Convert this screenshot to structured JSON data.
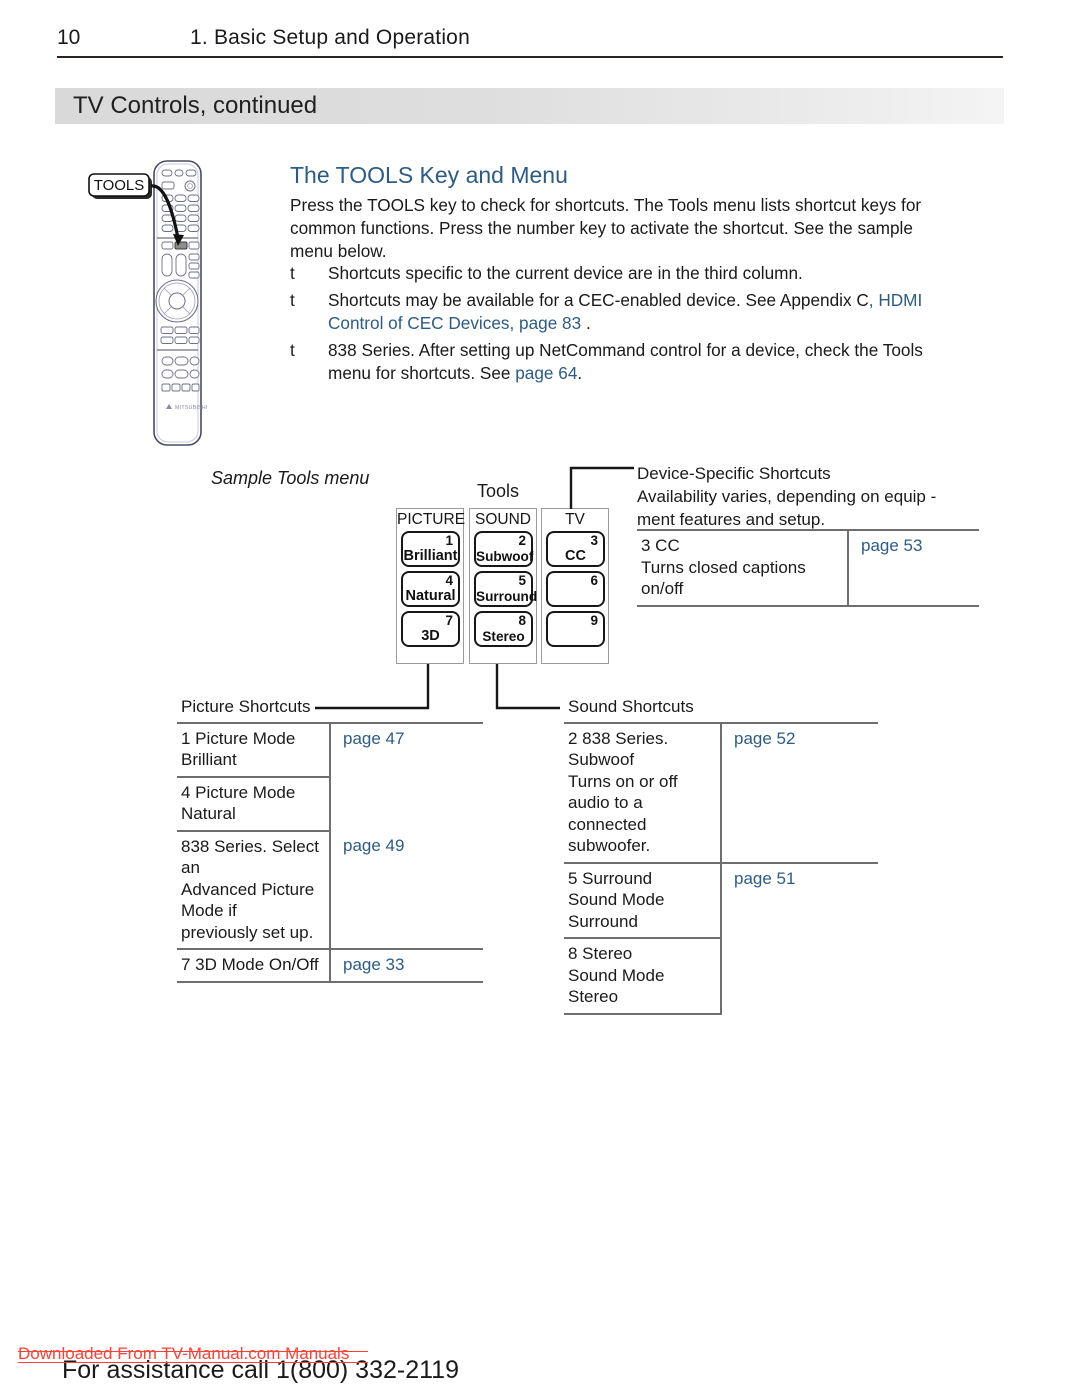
{
  "running_head": {
    "page_number": "10",
    "chapter": "1.  Basic Setup and Operation"
  },
  "section": {
    "title": "TV Controls, continued"
  },
  "remote": {
    "callout_label": "TOOLS",
    "brand": "MITSUBISHI"
  },
  "tools_section": {
    "heading": "The TOOLS Key and Menu",
    "intro": "Press the TOOLS key to check for shortcuts.  The  Tools  menu lists shortcut keys for common functions.  Press the number key to activate the shortcut.  See the sample menu below.",
    "bullets": [
      {
        "mark": "t",
        "text": "Shortcuts specific to the current device are in the third column.",
        "link_text": "",
        "tail": ""
      },
      {
        "mark": "t",
        "text": "Shortcuts may be available for a CEC-enabled device.  See  Appendix C",
        "link_text": ",  HDMI Control of CEC Devices,  page 83",
        "tail": " ."
      },
      {
        "mark": "t",
        "text": "838 Series.  After setting up NetCommand control for a device, check the Tools  menu for shortcuts.  See ",
        "link_text": "page 64",
        "tail": "."
      }
    ]
  },
  "sample_menu": {
    "caption": "Sample Tools menu",
    "tools_label": "Tools",
    "columns": [
      {
        "title": "PICTURE",
        "keys": [
          {
            "number": "1",
            "name": "Brilliant"
          },
          {
            "number": "4",
            "name": "Natural"
          },
          {
            "number": "7",
            "name": "3D"
          }
        ]
      },
      {
        "title": "SOUND",
        "keys": [
          {
            "number": "2",
            "name": "Subwoof"
          },
          {
            "number": "5",
            "name": "Surround"
          },
          {
            "number": "8",
            "name": "Stereo"
          }
        ]
      },
      {
        "title": "TV",
        "keys": [
          {
            "number": "3",
            "name": "CC"
          },
          {
            "number": "6",
            "name": ""
          },
          {
            "number": "9",
            "name": ""
          }
        ]
      }
    ]
  },
  "device_specific": {
    "title_line_1": "Device-Specific Shortcuts",
    "title_line_2": "Availability varies, depending on equip -",
    "title_line_3": "ment features and setup.",
    "rows": [
      {
        "text": "3  CC\nTurns closed captions\non/off",
        "page": "page 53"
      }
    ]
  },
  "picture_shortcuts": {
    "caption": "Picture Shortcuts",
    "rows": [
      {
        "text": "1  Picture Mode  Brilliant",
        "page": "page 47"
      },
      {
        "text": "4  Picture Mode  Natural",
        "page": ""
      },
      {
        "text": "838 Series.  Select an\nAdvanced Picture Mode if\npreviously set up.",
        "page": "page 49"
      },
      {
        "text": "7  3D Mode On/Off",
        "page": "page 33"
      }
    ]
  },
  "sound_shortcuts": {
    "caption": "Sound Shortcuts",
    "rows": [
      {
        "text": "2  838 Series.  Subwoof\nTurns on or off audio to a\nconnected subwoofer.",
        "page": "page 52"
      },
      {
        "text": "5  Surround\nSound Mode  Surround",
        "page": "page 51"
      },
      {
        "text": "8  Stereo\nSound Mode  Stereo",
        "page": ""
      }
    ]
  },
  "footer": {
    "assistance": "For assistance call 1(800) 332-2119",
    "watermark": "Downloaded From TV-Manual.com Manuals"
  },
  "colors": {
    "accent_blue": "#2c5c86",
    "banner_gray": "#d9d9d9",
    "rule_dark": "#2b2320",
    "watermark_red": "#ff4136"
  }
}
